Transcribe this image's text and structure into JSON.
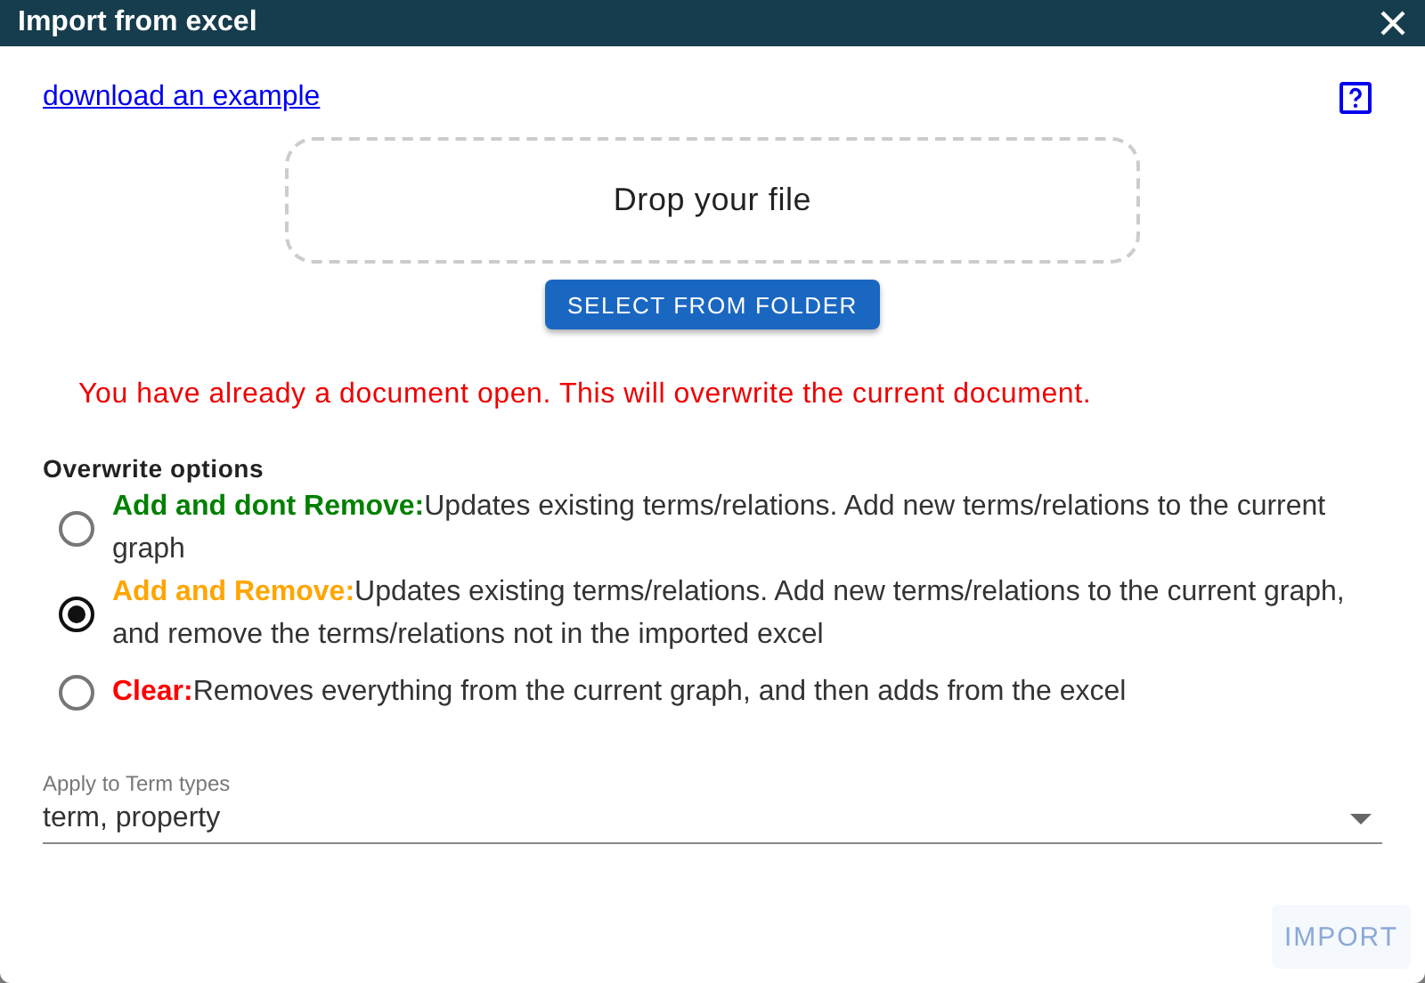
{
  "window": {
    "title": "Import from excel"
  },
  "example_link": "download an example",
  "dropzone": {
    "label": "Drop your file"
  },
  "select_button": "SELECT FROM FOLDER",
  "warning": "You have already a document open. This will overwrite the current document.",
  "overwrite": {
    "title": "Overwrite options",
    "options": [
      {
        "label": "Add and dont Remove:",
        "color": "#008000",
        "description": "Updates existing terms/relations. Add new terms/relations to the current graph",
        "selected": false
      },
      {
        "label": "Add and Remove:",
        "color": "#ffa500",
        "description": "Updates existing terms/relations. Add new terms/relations to the current graph, and remove the terms/relations not in the imported excel",
        "selected": true
      },
      {
        "label": "Clear:",
        "color": "#ff0000",
        "description": "Removes everything from the current graph, and then adds from the excel",
        "selected": false
      }
    ]
  },
  "term_types": {
    "label": "Apply to Term types",
    "value": "term, property"
  },
  "import_button": {
    "label": "IMPORT",
    "disabled": true
  }
}
